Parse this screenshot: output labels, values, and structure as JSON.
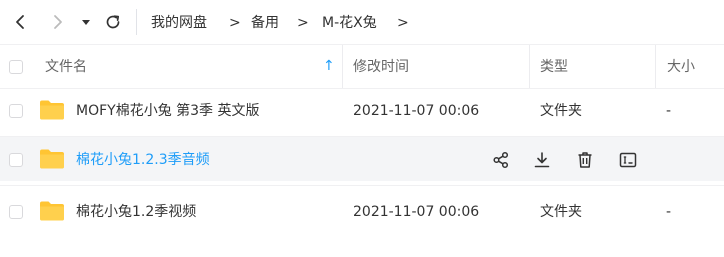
{
  "breadcrumb": {
    "items": [
      "我的网盘",
      "备用",
      "M-花X兔"
    ],
    "separator": ">"
  },
  "table": {
    "headers": {
      "name": "文件名",
      "modified": "修改时间",
      "type": "类型",
      "size": "大小"
    },
    "sort_indicator": "↑",
    "rows": [
      {
        "name": "MOFY棉花小兔 第3季 英文版",
        "modified": "2021-11-07 00:06",
        "type": "文件夹",
        "size": "-"
      },
      {
        "name": "棉花小兔1.2.3季音频"
      },
      {
        "name": "棉花小兔1.2季视频",
        "modified": "2021-11-07 00:06",
        "type": "文件夹",
        "size": "-"
      }
    ]
  },
  "colors": {
    "accent": "#1e9df8",
    "folder": "#ffc533",
    "hover_row": "#f4f5f7"
  },
  "icons": [
    "back-arrow-icon",
    "forward-arrow-icon",
    "history-dropdown-icon",
    "refresh-icon",
    "folder-icon",
    "share-icon",
    "download-icon",
    "delete-icon",
    "rename-icon"
  ]
}
